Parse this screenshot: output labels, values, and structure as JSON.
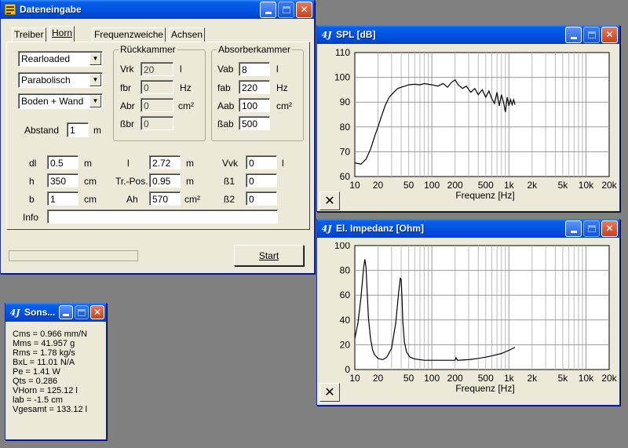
{
  "input_window": {
    "title": "Dateneingabe",
    "tabs": [
      {
        "label": "Treiber",
        "active": false
      },
      {
        "label": "Horn",
        "active": true
      },
      {
        "label": "Frequenzweiche",
        "active": false
      },
      {
        "label": "Achsen",
        "active": false
      }
    ],
    "combos": [
      "Rearloaded",
      "Parabolisch",
      "Boden + Wand"
    ],
    "abstand": {
      "label": "Abstand",
      "value": "1",
      "unit": "m"
    },
    "rueckkammer": {
      "title": "Rückkammer",
      "rows": [
        {
          "label": "Vrk",
          "value": "20",
          "unit": "l"
        },
        {
          "label": "fbr",
          "value": "0",
          "unit": "Hz"
        },
        {
          "label": "Abr",
          "value": "0",
          "unit": "cm²"
        },
        {
          "label": "ßbr",
          "value": "0",
          "unit": ""
        }
      ]
    },
    "absorberkammer": {
      "title": "Absorberkammer",
      "rows": [
        {
          "label": "Vab",
          "value": "8",
          "unit": "l"
        },
        {
          "label": "fab",
          "value": "220",
          "unit": "Hz"
        },
        {
          "label": "Aab",
          "value": "100",
          "unit": "cm²"
        },
        {
          "label": "ßab",
          "value": "500",
          "unit": ""
        }
      ]
    },
    "params_col1": [
      {
        "label": "dl",
        "value": "0.5",
        "unit": "m"
      },
      {
        "label": "h",
        "value": "350",
        "unit": "cm"
      },
      {
        "label": "b",
        "value": "1",
        "unit": "cm"
      }
    ],
    "params_col2": [
      {
        "label": "l",
        "value": "2.72",
        "unit": "m"
      },
      {
        "label": "Tr.-Pos.",
        "value": "0.95",
        "unit": "m"
      },
      {
        "label": "Ah",
        "value": "570",
        "unit": "cm²"
      }
    ],
    "params_col3": [
      {
        "label": "Vvk",
        "value": "0",
        "unit": "l"
      },
      {
        "label": "ß1",
        "value": "0",
        "unit": ""
      },
      {
        "label": "ß2",
        "value": "0",
        "unit": ""
      }
    ],
    "info": {
      "label": "Info",
      "value": ""
    },
    "start_label": "Start"
  },
  "sons_window": {
    "title": "Sons...",
    "lines": [
      "Cms = 0.966 mm/N",
      "Mms = 41.957 g",
      "Rms = 1.78 kg/s",
      "BxL = 11.01 N/A",
      "Pe = 1.41 W",
      "Qts = 0.286",
      "VHorn = 125.12 l",
      "lab = -1.5 cm",
      "Vgesamt = 133.12 l"
    ]
  },
  "x_tick_labels": [
    "10",
    "20",
    "50",
    "100",
    "200",
    "500",
    "1k",
    "2k",
    "5k",
    "10k",
    "20k"
  ],
  "chart_data": [
    {
      "type": "line",
      "title": "SPL [dB]",
      "xlabel": "Frequenz [Hz]",
      "ylabel": "",
      "x_scale": "log",
      "xlim": [
        10,
        20000
      ],
      "ylim": [
        60,
        110
      ],
      "yticks": [
        60,
        70,
        80,
        90,
        100,
        110
      ],
      "grid": true,
      "series": [
        {
          "x": [
            8,
            10,
            12,
            14,
            16,
            18,
            20,
            22,
            25,
            28,
            32,
            36,
            40,
            45,
            50,
            60,
            70,
            80,
            100,
            120,
            140,
            160,
            180,
            200,
            220,
            250,
            280,
            320,
            360,
            400,
            450,
            500,
            550,
            600,
            650,
            700,
            750,
            800,
            850,
            900,
            950,
            1000,
            1050,
            1100,
            1150,
            1200
          ],
          "y": [
            65.5,
            65.5,
            65,
            67,
            71,
            76,
            80,
            84,
            89,
            92,
            94,
            95.5,
            96,
            96.5,
            97,
            97.2,
            97,
            97.5,
            97,
            96.5,
            97.5,
            96,
            98,
            99,
            97,
            95.5,
            96.5,
            94,
            95.5,
            93,
            95,
            92,
            94.5,
            91.5,
            89.5,
            94,
            88.5,
            93,
            90,
            86,
            92,
            88.5,
            91,
            89,
            91,
            89
          ]
        }
      ]
    },
    {
      "type": "line",
      "title": "El. Impedanz [Ohm]",
      "xlabel": "Frequenz [Hz]",
      "ylabel": "",
      "x_scale": "log",
      "xlim": [
        10,
        20000
      ],
      "ylim": [
        0,
        100
      ],
      "yticks": [
        0,
        20,
        40,
        60,
        80,
        100
      ],
      "grid": true,
      "series": [
        {
          "x": [
            8,
            10,
            11,
            12,
            13,
            13.5,
            14,
            14.5,
            15,
            16,
            17,
            18,
            20,
            23,
            26,
            30,
            34,
            37,
            39,
            40,
            41,
            42,
            44,
            47,
            52,
            60,
            80,
            100,
            150,
            200,
            205,
            215,
            300,
            400,
            500,
            600,
            800,
            1000,
            1200
          ],
          "y": [
            18,
            25,
            38,
            58,
            82,
            89,
            82,
            62,
            42,
            25,
            16,
            12,
            9,
            8,
            10,
            17,
            38,
            62,
            74,
            72,
            58,
            38,
            22,
            14,
            10,
            8.5,
            7.5,
            7.5,
            7.5,
            7.5,
            9.5,
            7.5,
            8,
            9,
            10,
            11,
            13,
            15.5,
            18
          ]
        }
      ]
    }
  ]
}
